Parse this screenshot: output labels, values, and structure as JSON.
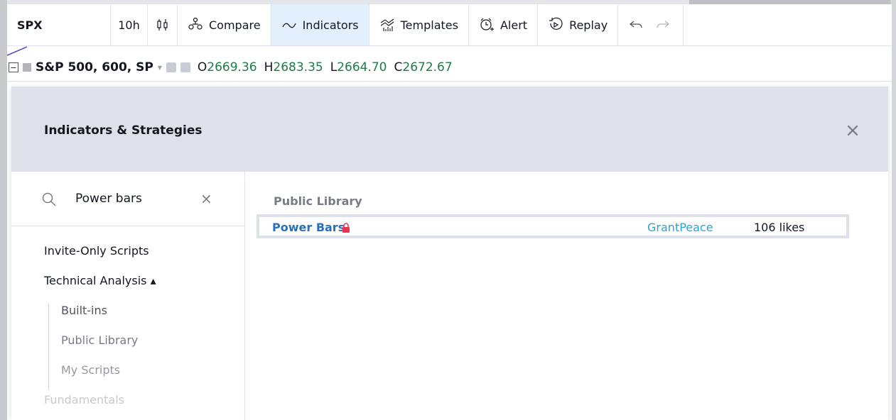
{
  "toolbar": {
    "symbol": "SPX",
    "interval": "10h",
    "compare": "Compare",
    "indicators": "Indicators",
    "templates": "Templates",
    "alert": "Alert",
    "replay": "Replay"
  },
  "legend": {
    "collapse_symbol": "−",
    "title": "S&P 500, 600, SP",
    "open_label": "O",
    "open": "2669.36",
    "high_label": "H",
    "high": "2683.35",
    "low_label": "L",
    "low": "2664.70",
    "close_label": "C",
    "close": "2672.67"
  },
  "dialog": {
    "title": "Indicators & Strategies",
    "search_value": "Power bars",
    "categories": [
      {
        "label": "Invite-Only Scripts",
        "color": "#131722"
      },
      {
        "label": "Technical Analysis ▴",
        "color": "#131722"
      },
      {
        "label": "Fundamentals",
        "color": "#c7c9cf"
      }
    ],
    "subcategories": [
      {
        "label": "Built-ins",
        "color": "#50535e"
      },
      {
        "label": "Public Library",
        "color": "#787b86"
      },
      {
        "label": "My Scripts",
        "color": "#9598a1"
      }
    ],
    "section_title": "Public Library",
    "results": [
      {
        "name": "Power Bars",
        "author": "GrantPeace",
        "likes": "106 likes"
      }
    ]
  },
  "colors": {
    "accent_blue": "#2a6fbb",
    "author_blue": "#2aa3d6",
    "lock_red": "#e8344e",
    "header_bg": "#dde1ea",
    "active_tab_bg": "#e3effd"
  }
}
